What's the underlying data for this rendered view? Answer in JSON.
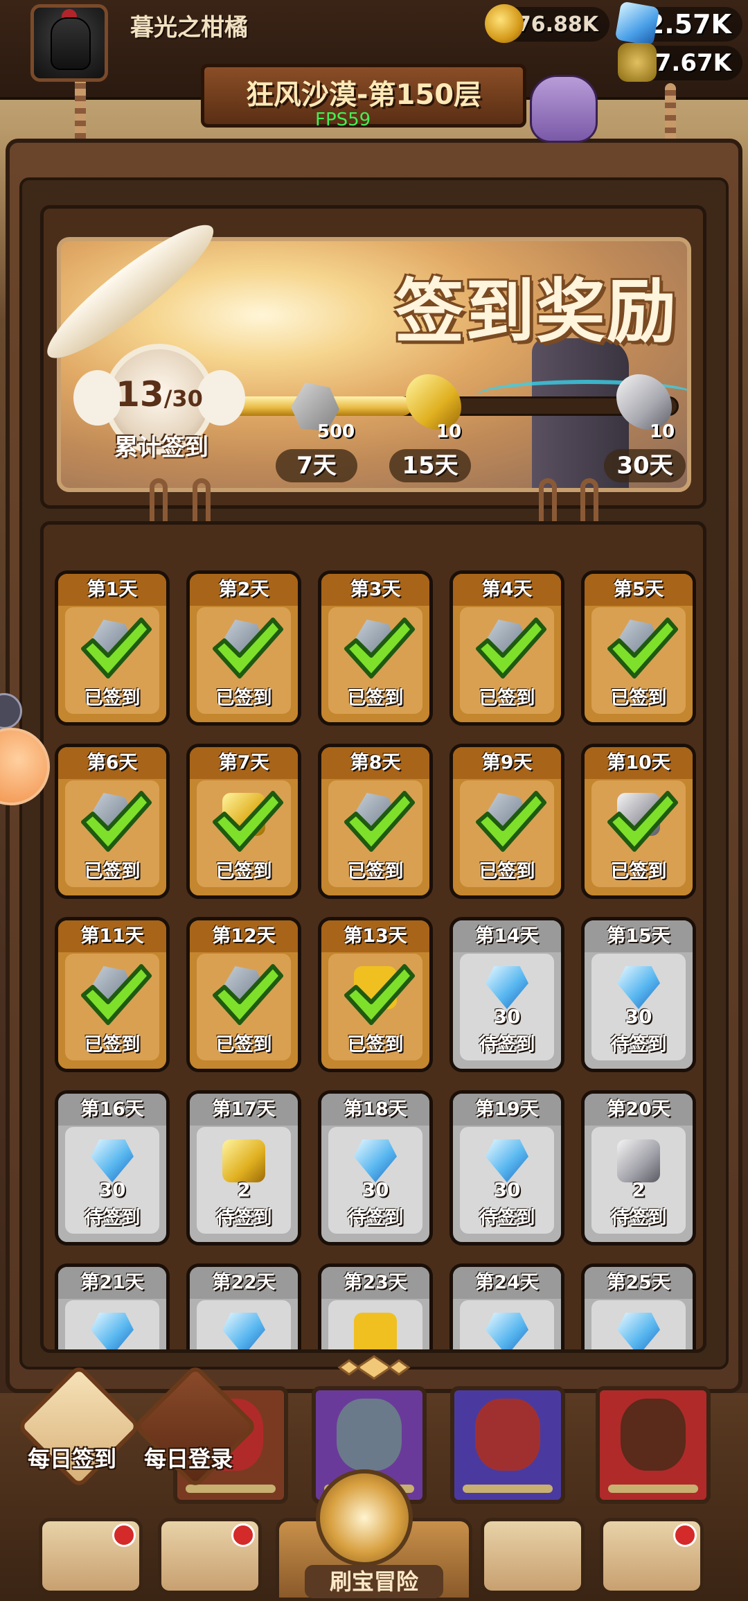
{
  "header": {
    "player_name": "暮光之柑橘",
    "gold": "476.88K",
    "gems": "2.57K",
    "tonic": "27.67K",
    "stage_title": "狂风沙漠-第150层",
    "fps": "FPS59"
  },
  "banner": {
    "title": "签到奖励",
    "checkin_current": "13",
    "checkin_total": "/30",
    "checkin_label": "累计签到",
    "checkin_progress_fraction": 0.4333,
    "milestones": [
      {
        "day_label": "7天",
        "qty": "500",
        "icon": "stone-icon"
      },
      {
        "day_label": "15天",
        "qty": "10",
        "icon": "gold-scroll-icon"
      },
      {
        "day_label": "30天",
        "qty": "10",
        "icon": "silver-scroll-icon"
      }
    ]
  },
  "grid": {
    "days": [
      {
        "label": "第1天",
        "status": "已签到",
        "icon": "stone-icon",
        "qty": "",
        "done": true
      },
      {
        "label": "第2天",
        "status": "已签到",
        "icon": "stone-icon",
        "qty": "",
        "done": true
      },
      {
        "label": "第3天",
        "status": "已签到",
        "icon": "stone-icon",
        "qty": "",
        "done": true
      },
      {
        "label": "第4天",
        "status": "已签到",
        "icon": "stone-icon",
        "qty": "",
        "done": true
      },
      {
        "label": "第5天",
        "status": "已签到",
        "icon": "stone-icon",
        "qty": "",
        "done": true
      },
      {
        "label": "第6天",
        "status": "已签到",
        "icon": "stone-icon",
        "qty": "",
        "done": true
      },
      {
        "label": "第7天",
        "status": "已签到",
        "icon": "gold-scroll-icon",
        "qty": "",
        "done": true
      },
      {
        "label": "第8天",
        "status": "已签到",
        "icon": "stone-icon",
        "qty": "",
        "done": true
      },
      {
        "label": "第9天",
        "status": "已签到",
        "icon": "stone-icon",
        "qty": "",
        "done": true
      },
      {
        "label": "第10天",
        "status": "已签到",
        "icon": "silver-scroll-icon",
        "qty": "",
        "done": true
      },
      {
        "label": "第11天",
        "status": "已签到",
        "icon": "stone-icon",
        "qty": "",
        "done": true
      },
      {
        "label": "第12天",
        "status": "已签到",
        "icon": "stone-icon",
        "qty": "",
        "done": true
      },
      {
        "label": "第13天",
        "status": "已签到",
        "icon": "puzzle-icon",
        "qty": "",
        "done": true
      },
      {
        "label": "第14天",
        "status": "待签到",
        "icon": "gem-icon",
        "qty": "30",
        "done": false
      },
      {
        "label": "第15天",
        "status": "待签到",
        "icon": "gem-icon",
        "qty": "30",
        "done": false
      },
      {
        "label": "第16天",
        "status": "待签到",
        "icon": "gem-icon",
        "qty": "30",
        "done": false
      },
      {
        "label": "第17天",
        "status": "待签到",
        "icon": "gold-scroll-icon",
        "qty": "2",
        "done": false
      },
      {
        "label": "第18天",
        "status": "待签到",
        "icon": "gem-icon",
        "qty": "30",
        "done": false
      },
      {
        "label": "第19天",
        "status": "待签到",
        "icon": "gem-icon",
        "qty": "30",
        "done": false
      },
      {
        "label": "第20天",
        "status": "待签到",
        "icon": "silver-scroll-icon",
        "qty": "2",
        "done": false
      },
      {
        "label": "第21天",
        "status": "",
        "icon": "gem-icon",
        "qty": "",
        "done": false
      },
      {
        "label": "第22天",
        "status": "",
        "icon": "gem-icon",
        "qty": "",
        "done": false
      },
      {
        "label": "第23天",
        "status": "",
        "icon": "puzzle-icon",
        "qty": "",
        "done": false
      },
      {
        "label": "第24天",
        "status": "",
        "icon": "gem-icon",
        "qty": "",
        "done": false
      },
      {
        "label": "第25天",
        "status": "",
        "icon": "gem-icon",
        "qty": "",
        "done": false
      }
    ]
  },
  "side_buttons": {
    "daily_checkin": "每日签到",
    "daily_login": "每日登录"
  },
  "bottom_nav": {
    "center_label": "刷宝冒险",
    "items": [
      "shop-icon",
      "hero-icon",
      "treasure-adventure-icon",
      "backpack-icon",
      "forge-icon"
    ]
  },
  "colors": {
    "done_cell": "#c4862e",
    "pending_cell": "#b2b2b2",
    "check_green": "#7ee02a",
    "notify_red": "#d42a2a"
  }
}
